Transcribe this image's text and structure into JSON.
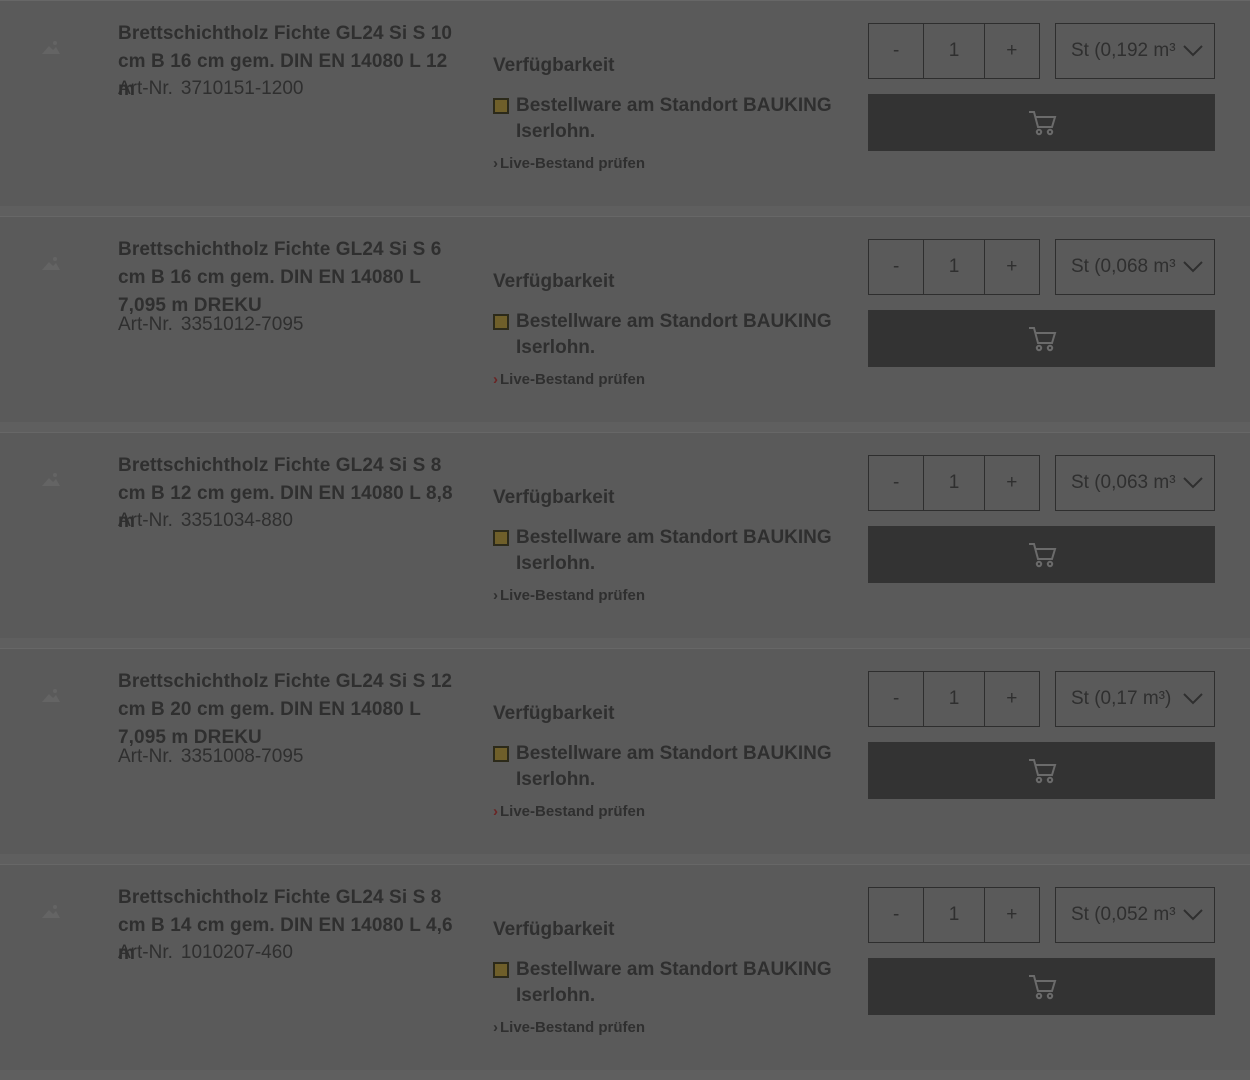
{
  "availability_heading": "Verfügbarkeit",
  "live_stock_label": "Live-Bestand prüfen",
  "art_nr_label": "Art-Nr.",
  "colors": {
    "background": "#5f5f5f",
    "cart_button": "#333333",
    "status_box": "#6f5f2a"
  },
  "products": [
    {
      "title": "Brettschichtholz Fichte GL24 Si S 10 cm B 16 cm gem. DIN EN 14080 L 12 m",
      "art_nr": "3710151-1200",
      "status": "Bestellware am Standort BAUKING Iserlohn.",
      "quantity": "1",
      "minus": "-",
      "plus": "+",
      "unit": "St (0,192 m³",
      "live_chevron_red": false
    },
    {
      "title": "Brettschichtholz Fichte GL24 Si S 6 cm B 16 cm gem. DIN EN 14080 L 7,095 m DREKU",
      "art_nr": "3351012-7095",
      "status": "Bestellware am Standort BAUKING Iserlohn.",
      "quantity": "1",
      "minus": "-",
      "plus": "+",
      "unit": "St (0,068 m³",
      "live_chevron_red": true
    },
    {
      "title": "Brettschichtholz Fichte GL24 Si S 8 cm B 12 cm gem. DIN EN 14080 L 8,8 m",
      "art_nr": "3351034-880",
      "status": "Bestellware am Standort BAUKING Iserlohn.",
      "quantity": "1",
      "minus": "-",
      "plus": "+",
      "unit": "St (0,063 m³",
      "live_chevron_red": false
    },
    {
      "title": "Brettschichtholz Fichte GL24 Si S 12 cm B 20 cm gem. DIN EN 14080 L 7,095 m DREKU",
      "art_nr": "3351008-7095",
      "status": "Bestellware am Standort BAUKING Iserlohn.",
      "quantity": "1",
      "minus": "-",
      "plus": "+",
      "unit": "St (0,17 m³)",
      "live_chevron_red": true
    },
    {
      "title": "Brettschichtholz Fichte GL24 Si S 8 cm B 14 cm gem. DIN EN 14080 L 4,6 m",
      "art_nr": "1010207-460",
      "status": "Bestellware am Standort BAUKING Iserlohn.",
      "quantity": "1",
      "minus": "-",
      "plus": "+",
      "unit": "St (0,052 m³",
      "live_chevron_red": false
    }
  ],
  "icons": {
    "cart": "cart-icon",
    "thumbnail": "product-image-placeholder-icon",
    "dropdown": "chevron-down-icon"
  }
}
